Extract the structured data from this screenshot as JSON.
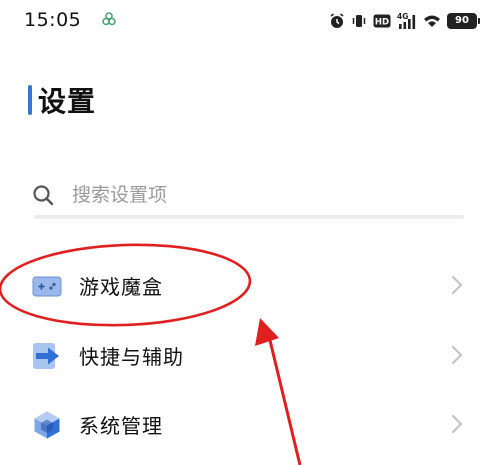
{
  "status_bar": {
    "time": "15:05",
    "network": "4G",
    "hd": "HD",
    "battery": "90",
    "icons": [
      "app-notification-icon",
      "alarm-icon",
      "vibrate-icon",
      "hd-icon",
      "signal-icon",
      "wifi-icon",
      "battery-icon"
    ]
  },
  "header": {
    "title": "设置"
  },
  "search": {
    "placeholder": "搜索设置项",
    "icon": "search-icon"
  },
  "menu": {
    "items": [
      {
        "label": "游戏魔盒",
        "icon": "game-box-icon"
      },
      {
        "label": "快捷与辅助",
        "icon": "shortcut-arrow-icon"
      },
      {
        "label": "系统管理",
        "icon": "system-cube-icon"
      }
    ]
  },
  "colors": {
    "accent": "#3a78d8",
    "annotation": "#e02020",
    "divider": "#ececec",
    "chevron": "#c4c4c4"
  }
}
